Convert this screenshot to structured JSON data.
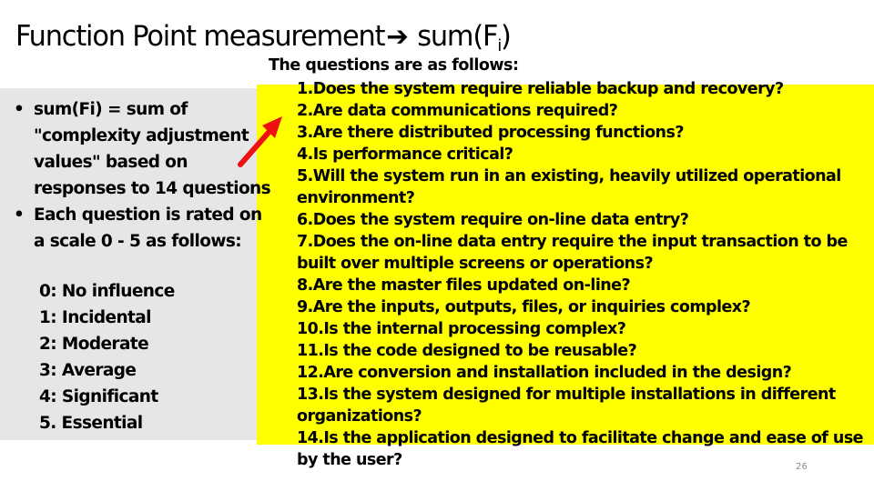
{
  "slide": {
    "title_main": "Function Point measurement",
    "title_arrow_icon": "➔",
    "title_suffix": " sum(F",
    "title_subscript": "i",
    "title_close": ")",
    "page_number": "26"
  },
  "left_panel": {
    "bullets": [
      "sum(Fi) = sum of \"complexity adjustment values\" based on responses to 14 questions",
      "Each question is rated on a scale 0 - 5 as follows:"
    ],
    "scale": [
      "0: No influence",
      "1: Incidental",
      "2: Moderate",
      "3: Average",
      "4: Significant",
      "5. Essential"
    ]
  },
  "questions_panel": {
    "heading": "The questions are as follows:",
    "items": [
      "1.Does the system require reliable backup and recovery?",
      "2.Are data communications required?",
      "3.Are there distributed processing functions?",
      "4.Is performance critical?",
      "5.Will the system run in an existing, heavily utilized operational environment?",
      "6.Does the system require on-line data entry?",
      "7.Does the on-line data entry require the input transaction to be built over multiple screens or operations?",
      "8.Are the master files updated on-line?",
      "9.Are the inputs, outputs, files, or inquiries complex?",
      "10.Is the internal processing complex?",
      "11.Is the code designed to be reusable?",
      "12.Are conversion and installation included in the design?",
      "13.Is the system designed for multiple installations in different organizations?",
      "14.Is the application designed to facilitate change and ease of use by the user?"
    ]
  },
  "colors": {
    "highlight_yellow": "#ffff00",
    "panel_gray": "#e6e6e6",
    "arrow_red": "#ee1111"
  }
}
